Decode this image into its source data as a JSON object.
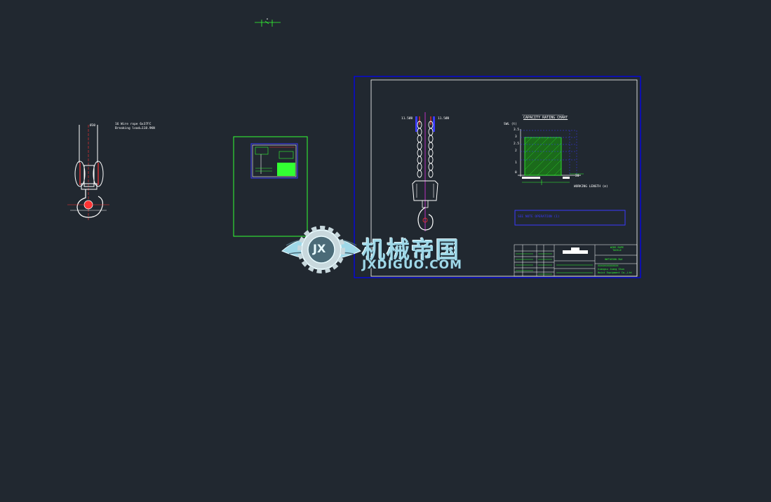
{
  "colors": {
    "background": "#212830",
    "sheet_frame": "#0000ff",
    "inner_frame": "#ffffff",
    "green": "#33ff33",
    "red": "#ff3333",
    "magenta": "#ff33ff",
    "watermark": "#9fd8e8"
  },
  "left_hook": {
    "top_label": "Ø30",
    "note_line1": "16 Wire rope 6x37FC",
    "note_line2": "Breaking load=118.9KN"
  },
  "main_sheet": {
    "dim_left": "11.5Ø8",
    "dim_right": "11.5Ø8",
    "chart_title": "CAPACITY RATING CHART",
    "y_axis_label": "SWL (t)",
    "y_ticks": [
      "3.5",
      "3",
      "2.5",
      "2",
      "1",
      "0"
    ],
    "x_axis_label": "WORKING LENGTH (m)",
    "x_end": "20",
    "note_box": "SEE NOTE OPERATION (1)",
    "title_block": {
      "name": "WIRE ROPE\nTACKLE",
      "drawing_no": "HWT16300-3&4",
      "company1": "XXXXXXXXXXXXXX",
      "company2": "Xiangsu Jiang Shun",
      "company3": "Hoist Equipment Co.,Ltd"
    }
  },
  "watermark": {
    "icon": "jx-gear-wings-icon",
    "cn": "机械帝国",
    "en": "JXDIGUO.COM",
    "badge": "JX"
  }
}
